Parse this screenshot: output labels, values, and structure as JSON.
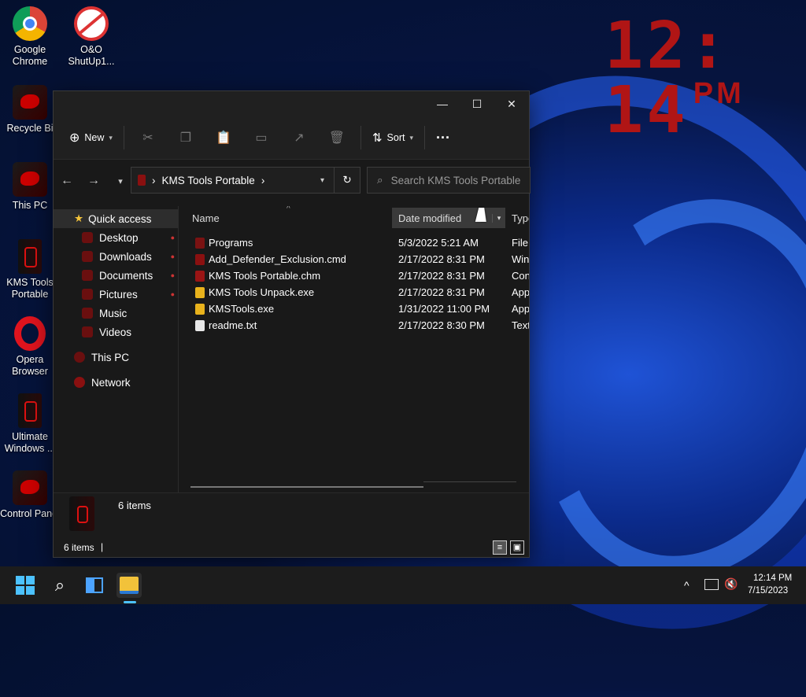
{
  "desktop": {
    "clock": {
      "time": "12: 14",
      "ampm": "PM"
    },
    "icons": [
      {
        "label": "Google Chrome",
        "icon": "chrome-icon"
      },
      {
        "label": "O&O ShutUp1...",
        "icon": "shutup-icon"
      },
      {
        "label": "Recycle Bi",
        "icon": "recycle-bin-icon"
      },
      {
        "label": "This PC",
        "icon": "this-pc-icon"
      },
      {
        "label": "KMS Tools Portable",
        "icon": "kms-tools-icon"
      },
      {
        "label": "Opera Browser",
        "icon": "opera-icon"
      },
      {
        "label": "Ultimate Windows ...",
        "icon": "ultimate-windows-icon"
      },
      {
        "label": "Control Panel",
        "icon": "control-panel-icon"
      }
    ]
  },
  "explorer": {
    "window_controls": {
      "minimize": "—",
      "maximize": "☐",
      "close": "✕"
    },
    "commands": {
      "new_label": "New",
      "sort_label": "Sort",
      "more_label": "···"
    },
    "address": {
      "path": "KMS Tools Portable",
      "sep": "›"
    },
    "search": {
      "placeholder": "Search KMS Tools Portable"
    },
    "navigation": {
      "quick_access": "Quick access",
      "items": [
        "Desktop",
        "Downloads",
        "Documents",
        "Pictures",
        "Music",
        "Videos"
      ],
      "this_pc": "This PC",
      "network": "Network"
    },
    "columns": {
      "name": "Name",
      "date": "Date modified",
      "type": "Type"
    },
    "files": [
      {
        "name": "Programs",
        "date": "5/3/2022 5:21 AM",
        "type": "File",
        "icon": "folder-icon"
      },
      {
        "name": "Add_Defender_Exclusion.cmd",
        "date": "2/17/2022 8:31 PM",
        "type": "Win",
        "icon": "cmd-file-icon"
      },
      {
        "name": "KMS Tools Portable.chm",
        "date": "2/17/2022 8:31 PM",
        "type": "Con",
        "icon": "chm-file-icon"
      },
      {
        "name": "KMS Tools Unpack.exe",
        "date": "2/17/2022 8:31 PM",
        "type": "App",
        "icon": "exe-file-icon"
      },
      {
        "name": "KMSTools.exe",
        "date": "1/31/2022 11:00 PM",
        "type": "App",
        "icon": "exe-file-icon"
      },
      {
        "name": "readme.txt",
        "date": "2/17/2022 8:30 PM",
        "type": "Text",
        "icon": "text-file-icon"
      }
    ],
    "details_pane": {
      "summary": "6 items"
    },
    "status_bar": {
      "count": "6 items",
      "divider": "|"
    }
  },
  "taskbar": {
    "clock_time": "12:14 PM",
    "clock_date": "7/15/2023",
    "tray_chevron": "^"
  },
  "colors": {
    "accent": "#0078d4",
    "clock_red": "#b01515",
    "window_bg": "#191919"
  }
}
